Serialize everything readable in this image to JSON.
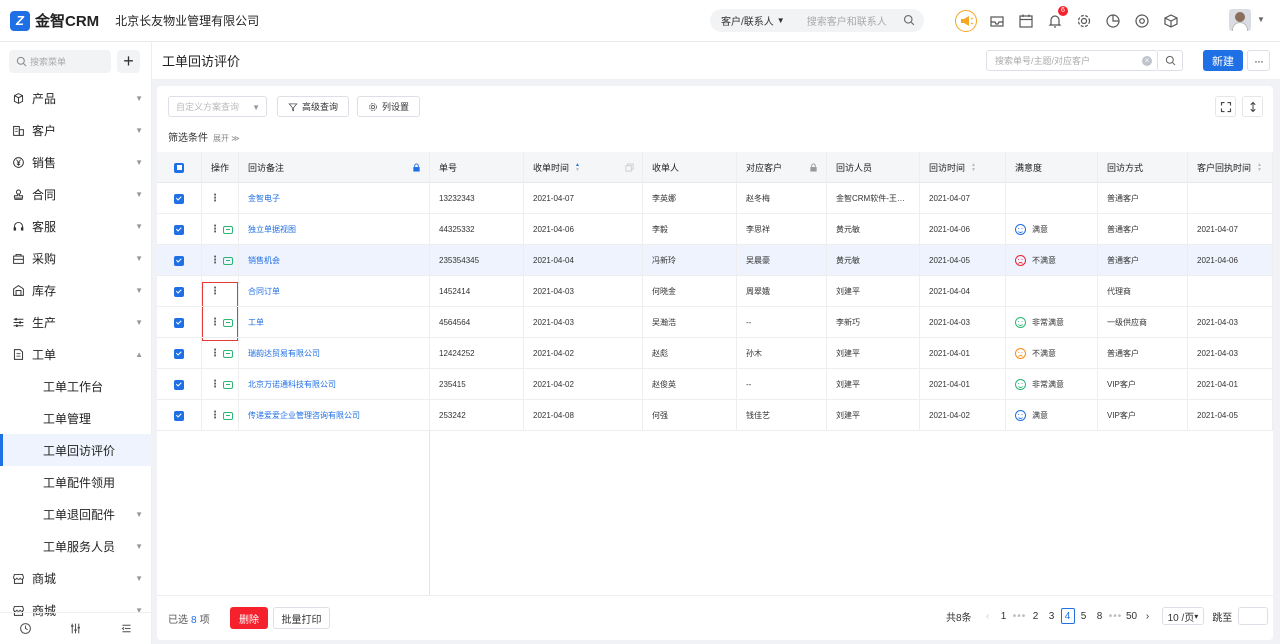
{
  "app": {
    "logo_text": "金智CRM",
    "company": "北京长友物业管理有限公司"
  },
  "global_search": {
    "scope": "客户/联系人",
    "placeholder": "搜索客户和联系人"
  },
  "notifications_badge": "6",
  "sidebar": {
    "search_placeholder": "搜索菜单",
    "items": [
      {
        "label": "产品",
        "icon": "cube-icon",
        "type": "group"
      },
      {
        "label": "客户",
        "icon": "building-icon",
        "type": "group"
      },
      {
        "label": "销售",
        "icon": "yen-icon",
        "type": "group"
      },
      {
        "label": "合同",
        "icon": "stamp-icon",
        "type": "group"
      },
      {
        "label": "客服",
        "icon": "headset-icon",
        "type": "group"
      },
      {
        "label": "采购",
        "icon": "bag-icon",
        "type": "group"
      },
      {
        "label": "库存",
        "icon": "warehouse-icon",
        "type": "group"
      },
      {
        "label": "生产",
        "icon": "sliders-icon",
        "type": "group"
      },
      {
        "label": "工单",
        "icon": "document-icon",
        "type": "open"
      },
      {
        "label": "工单工作台",
        "type": "sub"
      },
      {
        "label": "工单管理",
        "type": "sub"
      },
      {
        "label": "工单回访评价",
        "type": "sub-active"
      },
      {
        "label": "工单配件领用",
        "type": "sub"
      },
      {
        "label": "工单退回配件",
        "type": "sub-arrow"
      },
      {
        "label": "工单服务人员",
        "type": "sub-arrow"
      },
      {
        "label": "商城",
        "icon": "shop-icon",
        "type": "group"
      },
      {
        "label": "商城",
        "icon": "shop-icon",
        "type": "group"
      }
    ]
  },
  "header": {
    "title": "工单回访评价",
    "search_placeholder": "搜索单号/主题/对应客户",
    "new_label": "新建",
    "more_label": "···"
  },
  "filters": {
    "scheme_placeholder": "自定义方案查询",
    "advanced_label": "高级查询",
    "columns_label": "列设置",
    "condition_label": "筛选条件",
    "expand_label": "展开"
  },
  "table": {
    "columns": [
      "操作",
      "回访备注",
      "单号",
      "收单时间",
      "收单人",
      "对应客户",
      "回访人员",
      "回访时间",
      "满意度",
      "回访方式",
      "客户回执时间"
    ],
    "rows": [
      {
        "note": "金智电子",
        "no": "13232343",
        "recv_time": "2021-04-07",
        "receiver": "李英娜",
        "customer": "赵冬梅",
        "visitor": "金智CRM软件-王…",
        "visit_time": "2021-04-07",
        "sat": "",
        "sat_kind": "",
        "method": "普通客户",
        "reply_time": "",
        "msg": false
      },
      {
        "note": "独立单据视图",
        "no": "44325332",
        "recv_time": "2021-04-06",
        "receiver": "李毅",
        "customer": "李思祥",
        "visitor": "黄元敏",
        "visit_time": "2021-04-06",
        "sat": "满意",
        "sat_kind": "good",
        "method": "普通客户",
        "reply_time": "2021-04-07",
        "msg": true
      },
      {
        "note": "销售机会",
        "no": "235354345",
        "recv_time": "2021-04-04",
        "receiver": "冯新玲",
        "customer": "吴晨豪",
        "visitor": "黄元敏",
        "visit_time": "2021-04-05",
        "sat": "不满意",
        "sat_kind": "neg",
        "method": "普通客户",
        "reply_time": "2021-04-06",
        "msg": true
      },
      {
        "note": "合同订单",
        "no": "1452414",
        "recv_time": "2021-04-03",
        "receiver": "何晓金",
        "customer": "周翠娥",
        "visitor": "刘建平",
        "visit_time": "2021-04-04",
        "sat": "",
        "sat_kind": "",
        "method": "代理商",
        "reply_time": "",
        "msg": false
      },
      {
        "note": "工单",
        "no": "4564564",
        "recv_time": "2021-04-03",
        "receiver": "吴瀚浩",
        "customer": "--",
        "visitor": "李新巧",
        "visit_time": "2021-04-03",
        "sat": "非常满意",
        "sat_kind": "pos",
        "method": "一级供应商",
        "reply_time": "2021-04-03",
        "msg": true
      },
      {
        "note": "瑞韵达贸易有限公司",
        "no": "12424252",
        "recv_time": "2021-04-02",
        "receiver": "赵彪",
        "customer": "孙木",
        "visitor": "刘建平",
        "visit_time": "2021-04-01",
        "sat": "不满意",
        "sat_kind": "mid",
        "method": "普通客户",
        "reply_time": "2021-04-03",
        "msg": true
      },
      {
        "note": "北京万诺通科技有限公司",
        "no": "235415",
        "recv_time": "2021-04-02",
        "receiver": "赵俊英",
        "customer": "--",
        "visitor": "刘建平",
        "visit_time": "2021-04-01",
        "sat": "非常满意",
        "sat_kind": "pos",
        "method": "VIP客户",
        "reply_time": "2021-04-01",
        "msg": true
      },
      {
        "note": "传递爱爱企业管理咨询有限公司",
        "no": "253242",
        "recv_time": "2021-04-08",
        "receiver": "何强",
        "customer": "钱佳艺",
        "visitor": "刘建平",
        "visit_time": "2021-04-02",
        "sat": "满意",
        "sat_kind": "good",
        "method": "VIP客户",
        "reply_time": "2021-04-05",
        "msg": true
      }
    ]
  },
  "footer": {
    "selected_prefix": "已选",
    "selected_count": "8",
    "selected_suffix": "项",
    "delete_label": "删除",
    "print_label": "批量打印",
    "total": "共8条",
    "pages": [
      "1",
      "•••",
      "2",
      "3",
      "4",
      "5",
      "8",
      "•••",
      "50"
    ],
    "current_page": "4",
    "page_size": "10 /页",
    "jump_label": "跳至"
  },
  "colors": {
    "accent": "#1f6fe5",
    "danger": "#f5222d",
    "success": "#2bb673",
    "warn": "#fa8c16"
  }
}
